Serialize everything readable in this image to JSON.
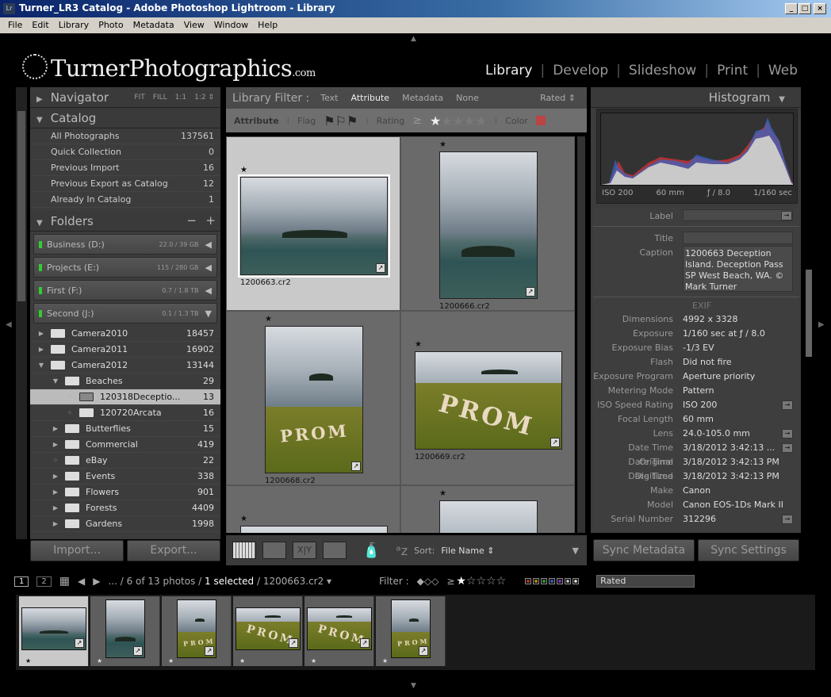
{
  "window": {
    "title": "Turner_LR3 Catalog - Adobe Photoshop Lightroom - Library",
    "app_icon": "Lr"
  },
  "menu": [
    "File",
    "Edit",
    "Library",
    "Photo",
    "Metadata",
    "View",
    "Window",
    "Help"
  ],
  "identity_plate": {
    "name": "TurnerPhotographics",
    "suffix": ".com"
  },
  "modules": [
    "Library",
    "Develop",
    "Slideshow",
    "Print",
    "Web"
  ],
  "navigator": {
    "title": "Navigator",
    "zoom": [
      "FIT",
      "FILL",
      "1:1",
      "1:2 ⇕"
    ]
  },
  "catalog": {
    "title": "Catalog",
    "items": [
      {
        "label": "All Photographs",
        "count": "137561"
      },
      {
        "label": "Quick Collection",
        "count": "0"
      },
      {
        "label": "Previous Import",
        "count": "16"
      },
      {
        "label": "Previous Export as Catalog",
        "count": "12"
      },
      {
        "label": "Already In Catalog",
        "count": "1"
      }
    ]
  },
  "folders": {
    "title": "Folders",
    "minus": "−",
    "plus": "+",
    "volumes": [
      {
        "label": "Business (D:)",
        "size": "22.0 / 39 GB",
        "arrow": "◀"
      },
      {
        "label": "Projects (E:)",
        "size": "115 / 280 GB",
        "arrow": "◀"
      },
      {
        "label": "First (F:)",
        "size": "0.7 / 1.8 TB",
        "arrow": "◀"
      },
      {
        "label": "Second (J:)",
        "size": "0.1 / 1.3 TB",
        "arrow": "▼"
      }
    ],
    "tree": [
      {
        "label": "Camera2010",
        "count": "18457",
        "level": 0,
        "exp": "▶"
      },
      {
        "label": "Camera2011",
        "count": "16902",
        "level": 0,
        "exp": "▶"
      },
      {
        "label": "Camera2012",
        "count": "13144",
        "level": 0,
        "exp": "▼"
      },
      {
        "label": "Beaches",
        "count": "29",
        "level": 1,
        "exp": "▼"
      },
      {
        "label": "120318Deceptio...",
        "count": "13",
        "level": 2,
        "exp": "⁘",
        "selected": true
      },
      {
        "label": "120720Arcata",
        "count": "16",
        "level": 2,
        "exp": "⁘"
      },
      {
        "label": "Butterflies",
        "count": "15",
        "level": 1,
        "exp": "▶"
      },
      {
        "label": "Commercial",
        "count": "419",
        "level": 1,
        "exp": "▶"
      },
      {
        "label": "eBay",
        "count": "22",
        "level": 1,
        "exp": "⁘"
      },
      {
        "label": "Events",
        "count": "338",
        "level": 1,
        "exp": "▶"
      },
      {
        "label": "Flowers",
        "count": "901",
        "level": 1,
        "exp": "▶"
      },
      {
        "label": "Forests",
        "count": "4409",
        "level": 1,
        "exp": "▶"
      },
      {
        "label": "Gardens",
        "count": "1998",
        "level": 1,
        "exp": "▶"
      }
    ]
  },
  "left_buttons": {
    "import": "Import...",
    "export": "Export..."
  },
  "filter": {
    "label": "Library Filter :",
    "tabs": [
      "Text",
      "Attribute",
      "Metadata",
      "None"
    ],
    "active": "Attribute",
    "preset": "Rated ⇕",
    "attribute_label": "Attribute",
    "flag_label": "Flag",
    "rating_label": "Rating",
    "rating_op": "≥",
    "rating_value": 1,
    "color_label": "Color"
  },
  "grid": [
    {
      "file": "1200663.cr2",
      "stars": "★",
      "orient": "land",
      "scene": "island",
      "selected": true
    },
    {
      "file": "1200666.cr2",
      "stars": "★",
      "orient": "port",
      "scene": "island"
    },
    {
      "file": "1200668.cr2",
      "stars": "★",
      "orient": "port",
      "scene": "prom"
    },
    {
      "file": "1200669.cr2",
      "stars": "★",
      "orient": "land",
      "scene": "prom"
    },
    {
      "file": "",
      "stars": "★",
      "orient": "land",
      "scene": "island"
    },
    {
      "file": "",
      "stars": "★",
      "orient": "port",
      "scene": "island"
    }
  ],
  "toolbar": {
    "sort_label": "Sort:",
    "sort_value": "File Name ⇕"
  },
  "histogram": {
    "title": "Histogram",
    "iso": "ISO 200",
    "focal": "60 mm",
    "aperture": "ƒ / 8.0",
    "shutter": "1/160 sec"
  },
  "metadata": {
    "label_key": "Label",
    "title_key": "Title",
    "caption_key": "Caption",
    "caption": "1200663 Deception Island. Deception Pass SP West Beach, WA. © Mark Turner",
    "exif_heading": "EXIF",
    "exif": [
      {
        "k": "Dimensions",
        "v": "4992 x 3328"
      },
      {
        "k": "Exposure",
        "v": "1/160 sec at ƒ / 8.0"
      },
      {
        "k": "Exposure Bias",
        "v": "-1/3 EV"
      },
      {
        "k": "Flash",
        "v": "Did not fire"
      },
      {
        "k": "Exposure Program",
        "v": "Aperture priority"
      },
      {
        "k": "Metering Mode",
        "v": "Pattern"
      },
      {
        "k": "ISO Speed Rating",
        "v": "ISO 200",
        "arrow": true
      },
      {
        "k": "Focal Length",
        "v": "60 mm"
      },
      {
        "k": "Lens",
        "v": "24.0-105.0 mm",
        "arrow": true
      },
      {
        "k": "Date Time Original",
        "v": "3/18/2012 3:42:13 ...",
        "arrow": true
      },
      {
        "k": "Date Time Digitized",
        "v": "3/18/2012 3:42:13 PM"
      },
      {
        "k": "Date Time",
        "v": "3/18/2012 3:42:13 PM"
      },
      {
        "k": "Make",
        "v": "Canon"
      },
      {
        "k": "Model",
        "v": "Canon EOS-1Ds Mark II"
      },
      {
        "k": "Serial Number",
        "v": "312296",
        "arrow": true
      }
    ]
  },
  "sync": {
    "metadata": "Sync Metadata",
    "settings": "Sync Settings"
  },
  "filmstrip_bar": {
    "screen1": "1",
    "screen2": "2",
    "path": "... / 6 of 13 photos / ",
    "selected": "1 selected",
    "file": " / 1200663.cr2 ▾",
    "filter_label": "Filter :",
    "rating_op": "≥",
    "label_colors": [
      "#c33",
      "#c90",
      "#3a3",
      "#36c",
      "#83c",
      "#ccc",
      "#eee"
    ],
    "preset": "Rated"
  },
  "filmstrip": [
    {
      "orient": "land",
      "scene": "island",
      "selected": true
    },
    {
      "orient": "port",
      "scene": "island"
    },
    {
      "orient": "port",
      "scene": "prom"
    },
    {
      "orient": "land",
      "scene": "prom"
    },
    {
      "orient": "land",
      "scene": "prom"
    },
    {
      "orient": "port",
      "scene": "prom"
    }
  ]
}
